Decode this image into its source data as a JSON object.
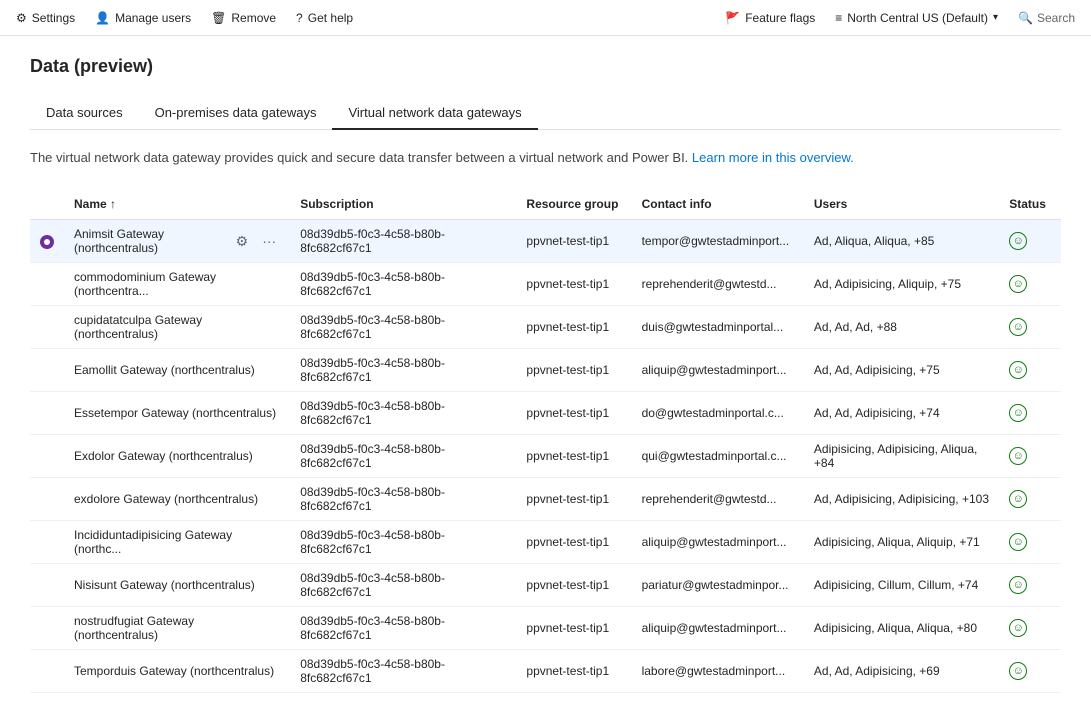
{
  "topbar": {
    "left": [
      {
        "id": "settings",
        "icon": "⚙",
        "label": "Settings"
      },
      {
        "id": "manage-users",
        "icon": "👤",
        "label": "Manage users"
      },
      {
        "id": "remove",
        "icon": "🗑",
        "label": "Remove"
      },
      {
        "id": "get-help",
        "icon": "?",
        "label": "Get help"
      }
    ],
    "right": [
      {
        "id": "feature-flags",
        "icon": "🚩",
        "label": "Feature flags"
      },
      {
        "id": "region",
        "icon": "≡",
        "label": "North Central US (Default)"
      },
      {
        "id": "search",
        "icon": "🔍",
        "label": "Search"
      }
    ]
  },
  "page": {
    "title": "Data (preview)"
  },
  "tabs": [
    {
      "id": "data-sources",
      "label": "Data sources",
      "active": false
    },
    {
      "id": "on-premises",
      "label": "On-premises data gateways",
      "active": false
    },
    {
      "id": "vnet",
      "label": "Virtual network data gateways",
      "active": true
    }
  ],
  "info": {
    "text": "The virtual network data gateway provides quick and secure data transfer between a virtual network and Power BI.",
    "link_text": "Learn more in this overview.",
    "link_href": "#"
  },
  "table": {
    "columns": [
      {
        "id": "check",
        "label": ""
      },
      {
        "id": "name",
        "label": "Name ↑"
      },
      {
        "id": "subscription",
        "label": "Subscription"
      },
      {
        "id": "resource-group",
        "label": "Resource group"
      },
      {
        "id": "contact-info",
        "label": "Contact info"
      },
      {
        "id": "users",
        "label": "Users"
      },
      {
        "id": "status",
        "label": "Status"
      }
    ],
    "rows": [
      {
        "selected": true,
        "name": "Animsit Gateway (northcentralus)",
        "subscription": "08d39db5-f0c3-4c58-b80b-8fc682cf67c1",
        "resource_group": "ppvnet-test-tip1",
        "contact_info": "tempor@gwtestadminport...",
        "users": "Ad, Aliqua, Aliqua, +85",
        "status": "ok",
        "has_actions": true
      },
      {
        "selected": false,
        "name": "commodominium Gateway (northcentra...",
        "subscription": "08d39db5-f0c3-4c58-b80b-8fc682cf67c1",
        "resource_group": "ppvnet-test-tip1",
        "contact_info": "reprehenderit@gwtestd...",
        "users": "Ad, Adipisicing, Aliquip, +75",
        "status": "ok",
        "has_actions": false
      },
      {
        "selected": false,
        "name": "cupidatatculpa Gateway (northcentralus)",
        "subscription": "08d39db5-f0c3-4c58-b80b-8fc682cf67c1",
        "resource_group": "ppvnet-test-tip1",
        "contact_info": "duis@gwtestadminportal...",
        "users": "Ad, Ad, Ad, +88",
        "status": "ok",
        "has_actions": false
      },
      {
        "selected": false,
        "name": "Eamollit Gateway (northcentralus)",
        "subscription": "08d39db5-f0c3-4c58-b80b-8fc682cf67c1",
        "resource_group": "ppvnet-test-tip1",
        "contact_info": "aliquip@gwtestadminport...",
        "users": "Ad, Ad, Adipisicing, +75",
        "status": "ok",
        "has_actions": false
      },
      {
        "selected": false,
        "name": "Essetempor Gateway (northcentralus)",
        "subscription": "08d39db5-f0c3-4c58-b80b-8fc682cf67c1",
        "resource_group": "ppvnet-test-tip1",
        "contact_info": "do@gwtestadminportal.c...",
        "users": "Ad, Ad, Adipisicing, +74",
        "status": "ok",
        "has_actions": false
      },
      {
        "selected": false,
        "name": "Exdolor Gateway (northcentralus)",
        "subscription": "08d39db5-f0c3-4c58-b80b-8fc682cf67c1",
        "resource_group": "ppvnet-test-tip1",
        "contact_info": "qui@gwtestadminportal.c...",
        "users": "Adipisicing, Adipisicing, Aliqua, +84",
        "status": "ok",
        "has_actions": false
      },
      {
        "selected": false,
        "name": "exdolore Gateway (northcentralus)",
        "subscription": "08d39db5-f0c3-4c58-b80b-8fc682cf67c1",
        "resource_group": "ppvnet-test-tip1",
        "contact_info": "reprehenderit@gwtestd...",
        "users": "Ad, Adipisicing, Adipisicing, +103",
        "status": "ok",
        "has_actions": false
      },
      {
        "selected": false,
        "name": "Incididuntadipisicing Gateway (northc...",
        "subscription": "08d39db5-f0c3-4c58-b80b-8fc682cf67c1",
        "resource_group": "ppvnet-test-tip1",
        "contact_info": "aliquip@gwtestadminport...",
        "users": "Adipisicing, Aliqua, Aliquip, +71",
        "status": "ok",
        "has_actions": false
      },
      {
        "selected": false,
        "name": "Nisisunt Gateway (northcentralus)",
        "subscription": "08d39db5-f0c3-4c58-b80b-8fc682cf67c1",
        "resource_group": "ppvnet-test-tip1",
        "contact_info": "pariatur@gwtestadminpor...",
        "users": "Adipisicing, Cillum, Cillum, +74",
        "status": "ok",
        "has_actions": false
      },
      {
        "selected": false,
        "name": "nostrudfugiat Gateway (northcentralus)",
        "subscription": "08d39db5-f0c3-4c58-b80b-8fc682cf67c1",
        "resource_group": "ppvnet-test-tip1",
        "contact_info": "aliquip@gwtestadminport...",
        "users": "Adipisicing, Aliqua, Aliqua, +80",
        "status": "ok",
        "has_actions": false
      },
      {
        "selected": false,
        "name": "Temporduis Gateway (northcentralus)",
        "subscription": "08d39db5-f0c3-4c58-b80b-8fc682cf67c1",
        "resource_group": "ppvnet-test-tip1",
        "contact_info": "labore@gwtestadminport...",
        "users": "Ad, Ad, Adipisicing, +69",
        "status": "ok",
        "has_actions": false
      }
    ]
  }
}
